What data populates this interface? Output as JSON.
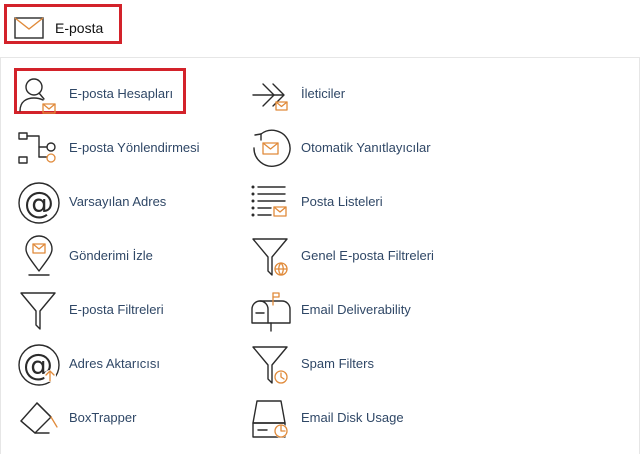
{
  "header": {
    "title": "E-posta",
    "icon": "envelope-icon",
    "accent_color": "#d3222a"
  },
  "colors": {
    "label": "#2f4766",
    "icon_stroke": "#2b2b2b",
    "icon_accent": "#e08a3a",
    "highlight": "#d3222a"
  },
  "items": [
    {
      "label": "E-posta Hesapları",
      "icon": "user-mail-icon"
    },
    {
      "label": "İleticiler",
      "icon": "forwarder-arrow-icon"
    },
    {
      "label": "E-posta Yönlendirmesi",
      "icon": "routing-icon"
    },
    {
      "label": "Otomatik Yanıtlayıcılar",
      "icon": "autoresponder-icon"
    },
    {
      "label": "Varsayılan Adres",
      "icon": "at-sign-icon"
    },
    {
      "label": "Posta Listeleri",
      "icon": "mailing-list-icon"
    },
    {
      "label": "Gönderimi İzle",
      "icon": "location-pin-mail-icon"
    },
    {
      "label": "Genel E-posta Filtreleri",
      "icon": "global-filter-icon"
    },
    {
      "label": "E-posta Filtreleri",
      "icon": "filter-icon"
    },
    {
      "label": "Email Deliverability",
      "icon": "mailbox-icon"
    },
    {
      "label": "Adres Aktarıcısı",
      "icon": "at-import-icon"
    },
    {
      "label": "Spam Filters",
      "icon": "spam-filter-icon"
    },
    {
      "label": "BoxTrapper",
      "icon": "boxtrapper-icon"
    },
    {
      "label": "Email Disk Usage",
      "icon": "disk-usage-icon"
    }
  ]
}
